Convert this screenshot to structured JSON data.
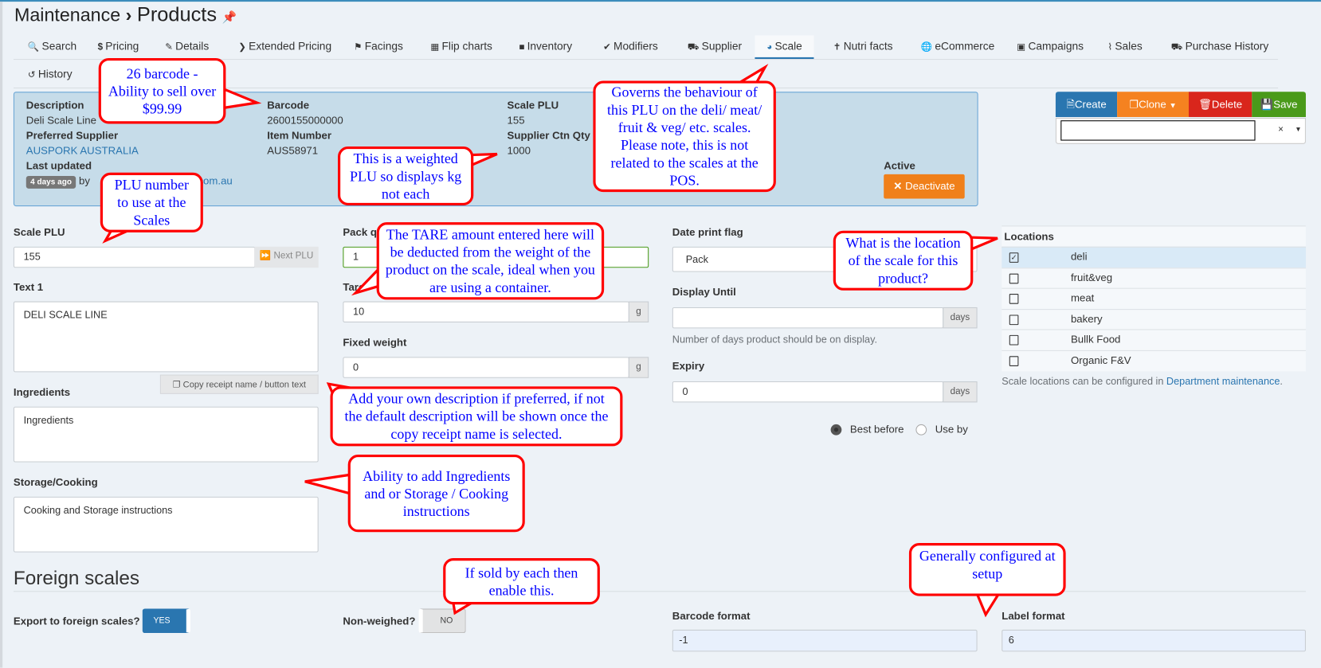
{
  "header": {
    "breadcrumb_parent": "Maintenance",
    "separator": "›",
    "title": "Products",
    "pin_icon": "pin-icon"
  },
  "tabs": [
    {
      "label": "Search",
      "icon": "search-icon"
    },
    {
      "label": "Pricing",
      "icon": "dollar-icon"
    },
    {
      "label": "Details",
      "icon": "edit-icon"
    },
    {
      "label": "Extended Pricing",
      "icon": "chevron-right-icon"
    },
    {
      "label": "Facings",
      "icon": "tags-icon"
    },
    {
      "label": "Flip charts",
      "icon": "grid-icon"
    },
    {
      "label": "Inventory",
      "icon": "archive-icon"
    },
    {
      "label": "Modifiers",
      "icon": "check-circle-icon"
    },
    {
      "label": "Supplier",
      "icon": "truck-icon"
    },
    {
      "label": "Scale",
      "icon": "dashboard-icon",
      "active": true
    },
    {
      "label": "Nutri facts",
      "icon": "cutlery-icon"
    },
    {
      "label": "eCommerce",
      "icon": "globe-icon"
    },
    {
      "label": "Campaigns",
      "icon": "calendar-icon"
    },
    {
      "label": "Sales",
      "icon": "line-chart-icon"
    },
    {
      "label": "Purchase History",
      "icon": "truck-loading-icon"
    },
    {
      "label": "History",
      "icon": "history-icon"
    }
  ],
  "summary": {
    "description_label": "Description",
    "description": "Deli Scale Line",
    "preferred_supplier_label": "Preferred Supplier",
    "preferred_supplier": "AUSPORK AUSTRALIA",
    "last_updated_label": "Last updated",
    "last_updated_badge": "4 days ago",
    "by": "by",
    "updated_by_visible": "ns.com.au",
    "barcode_label": "Barcode",
    "barcode": "2600155000000",
    "item_number_label": "Item Number",
    "item_number": "AUS58971",
    "scale_plu_label": "Scale PLU",
    "scale_plu": "155",
    "supplier_ctn_qty_label": "Supplier Ctn Qty",
    "supplier_ctn_qty": "1000",
    "active_label": "Active",
    "deactivate_label": "Deactivate"
  },
  "actions": {
    "create": "Create",
    "clone": "Clone",
    "delete": "Delete",
    "save": "Save",
    "select_clear": "×",
    "colors": {
      "create": "#2a76b0",
      "clone": "#f58220",
      "delete": "#d9261c",
      "save": "#4a9a1a",
      "deactivate": "#f0801a"
    }
  },
  "form": {
    "scale_plu_label": "Scale PLU",
    "scale_plu_value": "155",
    "next_plu": "Next PLU",
    "text1_label": "Text 1",
    "text1_value": "DELI SCALE LINE",
    "copy_receipt": "Copy receipt name / button text",
    "ingredients_label": "Ingredients",
    "ingredients_value": "Ingredients",
    "storage_label": "Storage/Cooking",
    "storage_value": "Cooking and Storage instructions",
    "pack_label": "Pack q",
    "pack_value": "1",
    "tare_label": "Tare",
    "tare_value": "10",
    "tare_unit": "g",
    "fixed_weight_label": "Fixed weight",
    "fixed_weight_value": "0",
    "fixed_weight_unit": "g",
    "date_print_flag_label": "Date print flag",
    "date_print_flag_value": "Pack",
    "display_until_label": "Display Until",
    "display_until_value": "",
    "display_until_unit": "days",
    "display_until_help": "Number of days product should be on display.",
    "expiry_label": "Expiry",
    "expiry_value": "0",
    "expiry_unit": "days",
    "best_before": "Best before",
    "use_by": "Use by",
    "selected_date_type": "Best before"
  },
  "locations": {
    "header": "Locations",
    "items": [
      {
        "name": "deli",
        "checked": true
      },
      {
        "name": "fruit&veg",
        "checked": false
      },
      {
        "name": "meat",
        "checked": false
      },
      {
        "name": "bakery",
        "checked": false
      },
      {
        "name": "Bullk Food",
        "checked": false
      },
      {
        "name": "Organic F&V",
        "checked": false
      }
    ],
    "footnote": "Scale locations can be configured in",
    "footnote_link": "Department maintenance",
    "footnote_end": "."
  },
  "foreign": {
    "heading": "Foreign scales",
    "export_label": "Export to foreign scales?",
    "export_value": "YES",
    "non_weighed_label": "Non-weighed?",
    "non_weighed_value": "NO",
    "barcode_format_label": "Barcode format",
    "barcode_format_value": "-1",
    "label_format_label": "Label format",
    "label_format_value": "6"
  },
  "callouts": [
    "26 barcode - Ability to sell over $99.99",
    "PLU number to use at the Scales",
    "This is a weighted PLU so displays kg not each",
    "Governs the behaviour of this PLU on the deli/ meat/ fruit & veg/ etc. scales.  Please note, this is not related to the scales at the POS.",
    "The TARE amount entered here will be deducted from the weight of the product on the scale, ideal when you are using a container.",
    "What is the location of the scale for this product?",
    "Add your own description if preferred, if not the default description will be shown once the copy receipt name is selected.",
    "Ability to add Ingredients and or Storage / Cooking instructions",
    "If sold by each then enable this.",
    "Generally configured at setup"
  ]
}
